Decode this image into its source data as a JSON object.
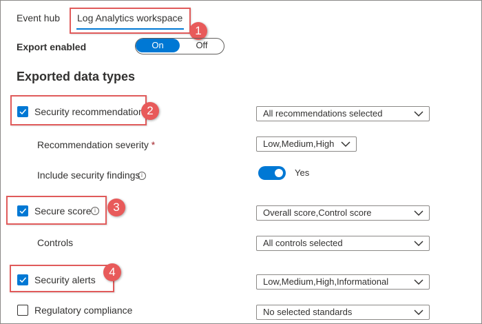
{
  "tabs": {
    "event_hub": "Event hub",
    "log_analytics": "Log Analytics workspace"
  },
  "export": {
    "label": "Export enabled",
    "on_label": "On",
    "off_label": "Off",
    "selected": "On"
  },
  "section_heading": "Exported data types",
  "rows": {
    "security_recommendations": {
      "label": "Security recommendations",
      "checked": true,
      "dropdown_value": "All recommendations selected"
    },
    "recommendation_severity": {
      "label": "Recommendation severity",
      "required_mark": "*",
      "dropdown_value": "Low,Medium,High"
    },
    "include_security_findings": {
      "label": "Include security findings",
      "toggle_label": "Yes",
      "toggle_on": true
    },
    "secure_score": {
      "label": "Secure score",
      "checked": true,
      "dropdown_value": "Overall score,Control score"
    },
    "controls": {
      "label": "Controls",
      "dropdown_value": "All controls selected"
    },
    "security_alerts": {
      "label": "Security alerts",
      "checked": true,
      "dropdown_value": "Low,Medium,High,Informational"
    },
    "regulatory_compliance": {
      "label": "Regulatory compliance",
      "checked": false,
      "dropdown_value": "No selected standards"
    }
  },
  "callouts": [
    "1",
    "2",
    "3",
    "4"
  ],
  "icons": {
    "info": "info-icon",
    "chevron": "chevron-down-icon",
    "check": "checkmark-icon"
  },
  "colors": {
    "accent": "#0078d4",
    "callout": "#e05a5a"
  }
}
